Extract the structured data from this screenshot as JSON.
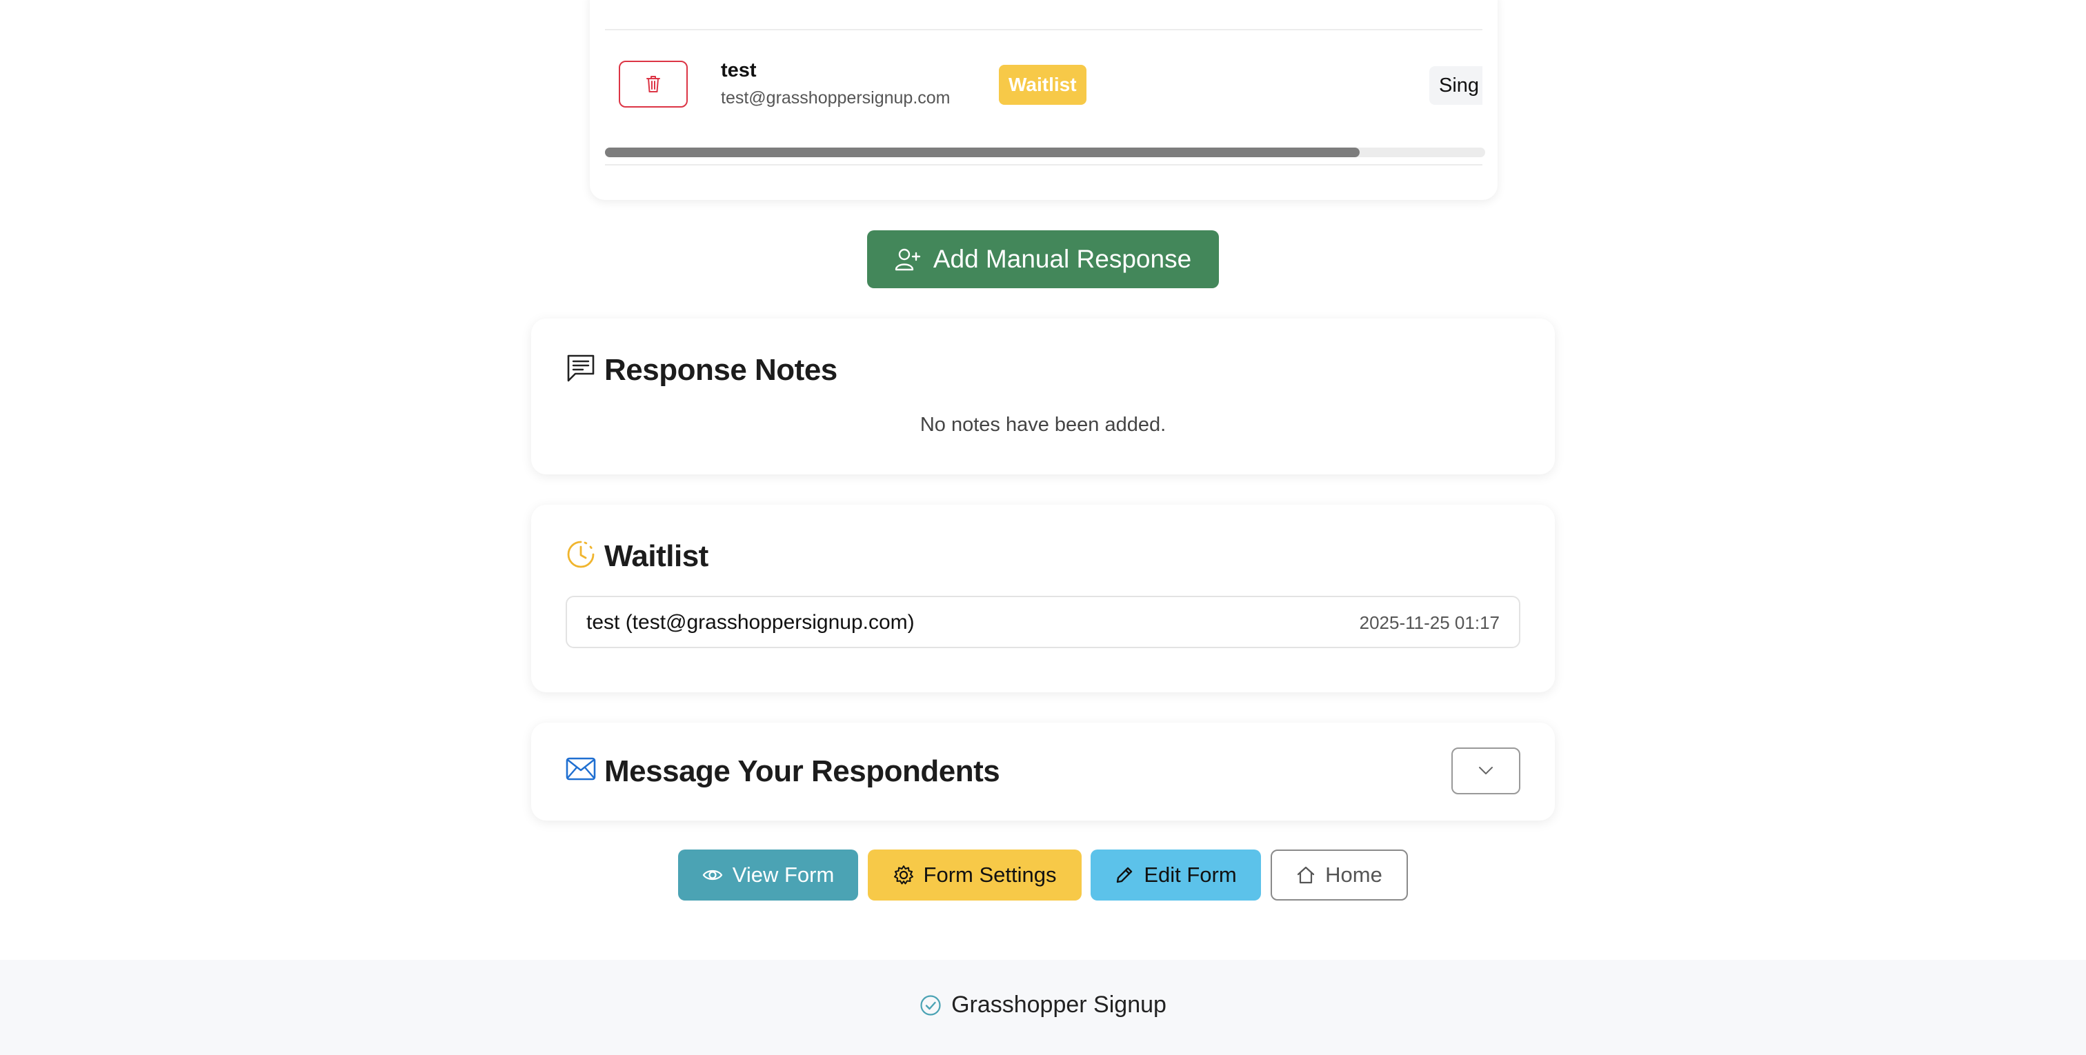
{
  "responses_table": {
    "rows": [
      {
        "name": "test",
        "email": "test@grasshoppersignup.com",
        "status": "Waitlist",
        "type": "Sing"
      }
    ],
    "scroll_position": 0.86
  },
  "add_manual_response": {
    "label": "Add Manual Response"
  },
  "response_notes": {
    "title": "Response Notes",
    "empty_text": "No notes have been added."
  },
  "waitlist": {
    "title": "Waitlist",
    "entries": [
      {
        "person": "test (test@grasshoppersignup.com)",
        "date": "2025-11-25 01:17"
      }
    ]
  },
  "message_respondents": {
    "title": "Message Your Respondents"
  },
  "actions": {
    "view_form": "View Form",
    "form_settings": "Form Settings",
    "edit_form": "Edit Form",
    "home": "Home"
  },
  "footer": {
    "brand": "Grasshopper Signup"
  },
  "colors": {
    "primary_green": "#43875a",
    "waitlist_yellow": "#f7c948",
    "teal": "#4ba3b4",
    "sky": "#5cc2ea",
    "danger": "#dc3545",
    "envelope_blue": "#1f6fd1"
  }
}
